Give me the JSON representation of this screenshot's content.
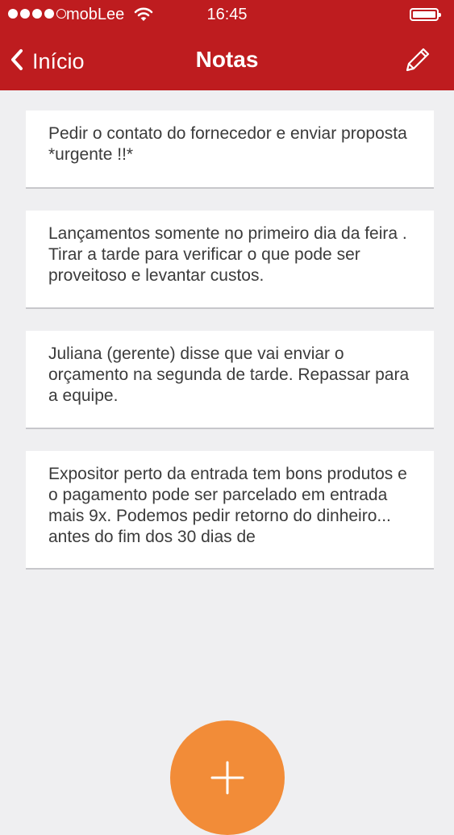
{
  "status_bar": {
    "carrier": "mobLee",
    "time": "16:45",
    "signal_bars_filled": 4,
    "signal_bars_total": 5,
    "battery_level": 1.0
  },
  "nav": {
    "back_label": "Início",
    "title": "Notas"
  },
  "notes": [
    {
      "text": "Pedir o contato do fornecedor e enviar proposta *urgente !!*"
    },
    {
      "text": "Lançamentos somente no primeiro dia da feira . Tirar a tarde para verificar o que pode ser proveitoso e levantar custos."
    },
    {
      "text": "Juliana (gerente) disse que vai enviar o orçamento na segunda de tarde. Repassar para a equipe."
    },
    {
      "text": "Expositor perto da entrada tem bons produtos e o pagamento pode ser parcelado em entrada mais 9x. Podemos pedir retorno do dinheiro... antes do fim dos 30 dias de"
    }
  ],
  "colors": {
    "header": "#be1c1f",
    "background": "#efeff1",
    "fab": "#f28c38",
    "note_text": "#3b3b3b"
  },
  "icons": {
    "back": "chevron-left-icon",
    "edit": "pencil-icon",
    "add": "plus-icon",
    "wifi": "wifi-icon",
    "battery": "battery-icon"
  }
}
